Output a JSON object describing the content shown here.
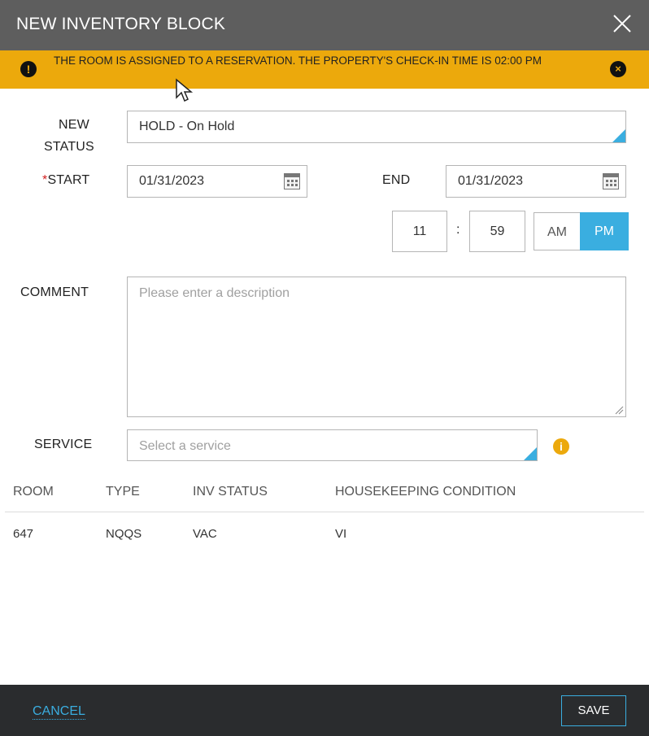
{
  "header": {
    "title": "NEW INVENTORY BLOCK"
  },
  "warning": {
    "icon": "exclamation-circle-icon",
    "text": "THE ROOM IS ASSIGNED TO A RESERVATION. THE PROPERTY'S CHECK-IN TIME IS 02:00 PM",
    "close_icon": "close-circle-icon"
  },
  "form": {
    "new_status_label_line1": "NEW",
    "new_status_label_line2": "STATUS",
    "new_status_value": "HOLD - On Hold",
    "start_required_mark": "*",
    "start_label": "START",
    "start_value": "01/31/2023",
    "end_label": "END",
    "end_value": "01/31/2023",
    "time": {
      "hour": "11",
      "separator": ":",
      "minute": "59",
      "am_label": "AM",
      "pm_label": "PM",
      "selected": "PM"
    },
    "comment_label": "COMMENT",
    "comment_placeholder": "Please enter a description",
    "service_label": "SERVICE",
    "service_placeholder": "Select a service",
    "service_info_icon": "info-icon"
  },
  "table": {
    "columns": [
      "ROOM",
      "TYPE",
      "INV STATUS",
      "HOUSEKEEPING CONDITION"
    ],
    "rows": [
      [
        "647",
        "NQQS",
        "VAC",
        "VI"
      ]
    ]
  },
  "footer": {
    "cancel_label": "CANCEL",
    "save_label": "SAVE"
  },
  "colors": {
    "header_bg": "#5e5e5e",
    "warning_bg": "#eca90c",
    "accent": "#3aaee0",
    "footer_bg": "#2a2c2e"
  }
}
